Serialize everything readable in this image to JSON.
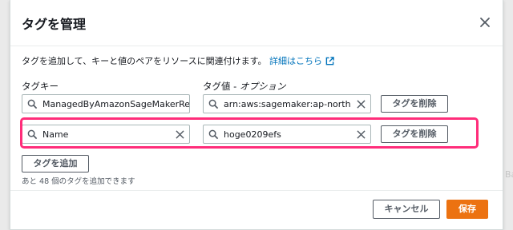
{
  "background": {
    "right_fragment": "Ba"
  },
  "modal": {
    "title": "タグを管理",
    "description": "タグを追加して、キーと値のペアをリソースに関連付けます。",
    "details_link": "詳細はこちら",
    "key_column_label": "タグキー",
    "value_column_label_main": "タグ値 - ",
    "value_column_label_option": "オプション",
    "tags": [
      {
        "key": "ManagedByAmazonSageMakerResou",
        "value": "arn:aws:sagemaker:ap-northeast-",
        "remove_label": "タグを削除"
      },
      {
        "key": "Name",
        "value": "hoge0209efs",
        "remove_label": "タグを削除"
      }
    ],
    "add_tag_label": "タグを追加",
    "remaining_hint": "あと 48 個のタグを追加できます",
    "cancel_label": "キャンセル",
    "save_label": "保存"
  },
  "icons": {
    "close": "close-icon",
    "external_link": "external-link-icon",
    "search": "search-icon",
    "clear": "clear-icon"
  },
  "colors": {
    "link": "#0073bb",
    "primary": "#ec7211",
    "highlight": "#ff2d7a"
  }
}
